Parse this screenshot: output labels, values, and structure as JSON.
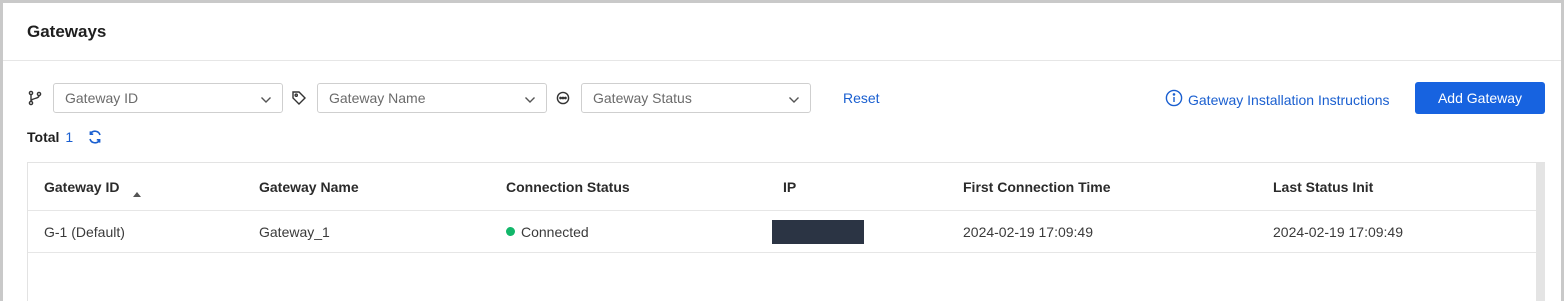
{
  "page": {
    "title": "Gateways"
  },
  "filters": {
    "gateway_id": {
      "placeholder": "Gateway ID",
      "icon": "branch-icon"
    },
    "gateway_name": {
      "placeholder": "Gateway Name",
      "icon": "tag-icon"
    },
    "gateway_status": {
      "placeholder": "Gateway Status",
      "icon": "status-icon"
    },
    "reset_label": "Reset"
  },
  "actions": {
    "install_label": "Gateway Installation Instructions",
    "add_label": "Add Gateway"
  },
  "summary": {
    "total_label": "Total",
    "total_count": "1"
  },
  "table": {
    "columns": [
      "Gateway ID",
      "Gateway Name",
      "Connection Status",
      "IP",
      "First Connection Time",
      "Last Status Init"
    ],
    "rows": [
      {
        "gateway_id": "G-1 (Default)",
        "gateway_name": "Gateway_1",
        "connection_status": "Connected",
        "first_connection_time": "2024-02-19 17:09:49",
        "last_status_init": "2024-02-19 17:09:49"
      }
    ]
  },
  "colors": {
    "accent": "#1763e0",
    "link": "#1a5fd0",
    "connected": "#12b76a",
    "ip_mask": "#2b3444"
  }
}
